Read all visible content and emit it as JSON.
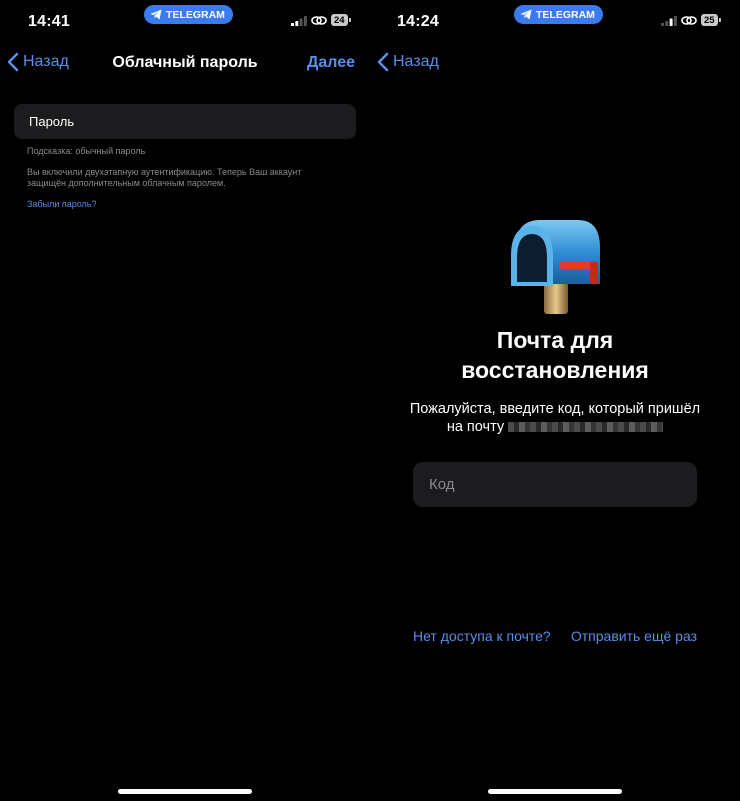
{
  "left": {
    "status": {
      "time": "14:41",
      "app_pill": "TELEGRAM",
      "battery": "24"
    },
    "nav": {
      "back": "Назад",
      "title": "Облачный пароль",
      "next": "Далее"
    },
    "password_field": {
      "value": "Пароль"
    },
    "hint": "Подсказка: обычный пароль",
    "info": "Вы включили двухэтапную аутентификацию. Теперь Ваш аккаунт защищён дополнительным облачным паролем.",
    "forgot": "Забыли пароль?"
  },
  "right": {
    "status": {
      "time": "14:24",
      "app_pill": "TELEGRAM",
      "battery": "25"
    },
    "nav": {
      "back": "Назад"
    },
    "heading_line1": "Почта для",
    "heading_line2": "восстановления",
    "desc_line1": "Пожалуйста, введите код, который пришёл",
    "desc_line2": "на почту",
    "code_field": {
      "placeholder": "Код"
    },
    "no_access": "Нет доступа к почте?",
    "resend": "Отправить ещё раз"
  },
  "colors": {
    "accent": "#5a8ee8",
    "pill": "#3a7bf0",
    "field_bg": "#1c1c1e",
    "secondary_text": "#8a8a8e"
  },
  "icons": [
    "telegram-plane-icon",
    "signal-icon",
    "link-icon",
    "battery-icon",
    "chevron-left-icon",
    "mailbox-icon"
  ]
}
